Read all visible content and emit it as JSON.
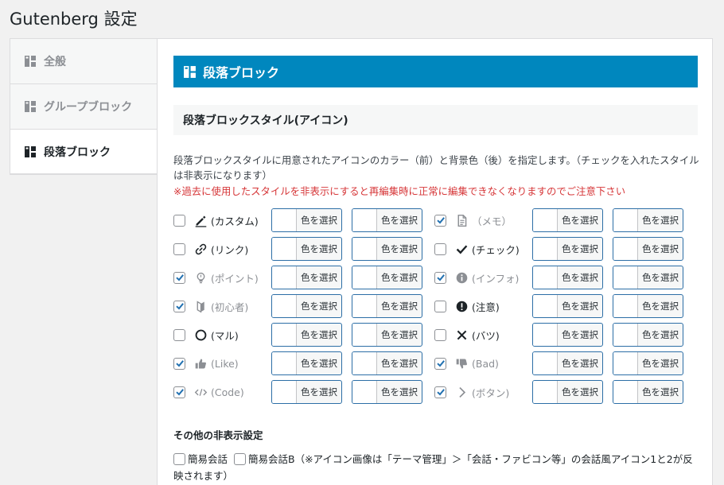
{
  "page": {
    "title": "Gutenberg 設定"
  },
  "sidebar": {
    "items": [
      {
        "label": "全般",
        "active": false
      },
      {
        "label": "グループブロック",
        "active": false
      },
      {
        "label": "段落ブロック",
        "active": true
      }
    ]
  },
  "main": {
    "banner": "段落ブロック",
    "subheading": "段落ブロックスタイル(アイコン)",
    "description": "段落ブロックスタイルに用意されたアイコンのカラー（前）と背景色（後）を指定します。（チェックを入れたスタイルは非表示になります）",
    "warning": "※過去に使用したスタイルを非表示にすると再編集時に正常に編集できなくなりますのでご注意下さい",
    "color_button_label": "色を選択",
    "styles": [
      {
        "label": "(カスタム)",
        "icon": "pencil-icon",
        "checked": false
      },
      {
        "label": "（メモ）",
        "icon": "memo-icon",
        "checked": true
      },
      {
        "label": "(リンク)",
        "icon": "link-icon",
        "checked": false
      },
      {
        "label": "(チェック)",
        "icon": "check-icon",
        "checked": false
      },
      {
        "label": "(ポイント)",
        "icon": "lightbulb-icon",
        "checked": true
      },
      {
        "label": "(インフォ)",
        "icon": "info-icon",
        "checked": true
      },
      {
        "label": "(初心者)",
        "icon": "beginner-icon",
        "checked": true
      },
      {
        "label": "(注意)",
        "icon": "exclamation-icon",
        "checked": false
      },
      {
        "label": "(マル)",
        "icon": "circle-icon",
        "checked": false
      },
      {
        "label": "(バツ)",
        "icon": "cross-icon",
        "checked": false
      },
      {
        "label": "(Like)",
        "icon": "thumbs-up-icon",
        "checked": true
      },
      {
        "label": "(Bad)",
        "icon": "thumbs-down-icon",
        "checked": true
      },
      {
        "label": "(Code)",
        "icon": "code-icon",
        "checked": true
      },
      {
        "label": "(ボタン)",
        "icon": "chevron-right-icon",
        "checked": true
      }
    ],
    "other_heading": "その他の非表示設定",
    "other_items": [
      {
        "label": "簡易会話",
        "checked": false
      },
      {
        "label": "簡易会話B",
        "checked": false
      }
    ],
    "other_note": "（※アイコン画像は「テーマ管理」＞「会話・ファビコン等」の会話風アイコン1と2が反映されます）"
  },
  "colors": {
    "accent": "#0087be",
    "check": "#2271b1",
    "warning": "#d63638"
  }
}
